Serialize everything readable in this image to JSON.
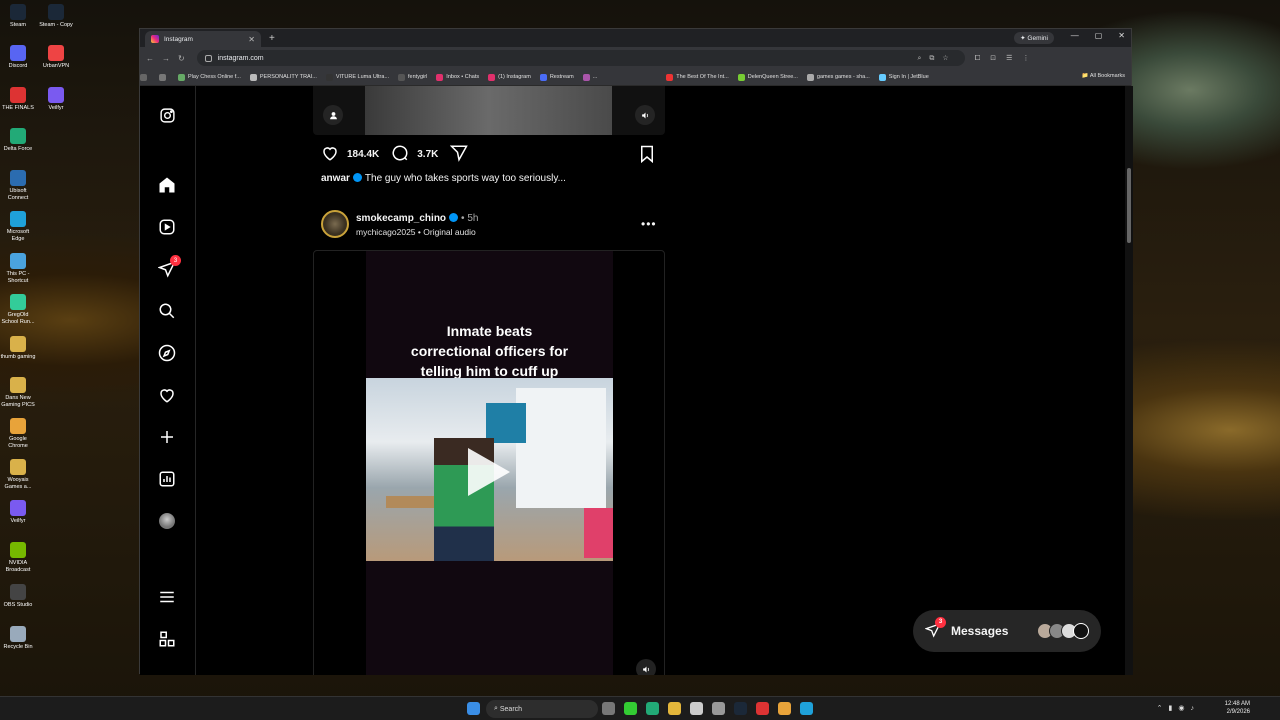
{
  "desktop": {
    "icons": [
      {
        "label": "Steam",
        "color": "#1b2838"
      },
      {
        "label": "Discord",
        "color": "#5865f2"
      },
      {
        "label": "THE FINALS",
        "color": "#d33"
      },
      {
        "label": "Delta Force",
        "color": "#2a7"
      },
      {
        "label": "Ubisoft Connect",
        "color": "#2b6cb0"
      },
      {
        "label": "Microsoft Edge",
        "color": "#1fa1d9"
      },
      {
        "label": "This PC - Shortcut",
        "color": "#4aa3df"
      },
      {
        "label": "GregOld School Run...",
        "color": "#3c9"
      },
      {
        "label": "thumb gaming",
        "color": "#d9b14a"
      },
      {
        "label": "Dans New Gaming PICS",
        "color": "#d9b14a"
      },
      {
        "label": "Google Chrome",
        "color": "#e8a33a"
      },
      {
        "label": "Wooyais Games a...",
        "color": "#d9b14a"
      },
      {
        "label": "Veilfyr",
        "color": "#7a5af0"
      },
      {
        "label": "NVIDIA Broadcast",
        "color": "#76b900"
      },
      {
        "label": "OBS Studio",
        "color": "#444"
      },
      {
        "label": "Recycle Bin",
        "color": "#9ab"
      }
    ],
    "icons_col2": [
      {
        "label": "Steam - Copy",
        "color": "#1b2838"
      },
      {
        "label": "UrbanVPN",
        "color": "#e44"
      },
      {
        "label": "Veilfyr",
        "color": "#7a5af0"
      }
    ]
  },
  "browser": {
    "tab_title": "Instagram",
    "gemini_label": "Gemini",
    "url": "instagram.com",
    "bookmarks": [
      "Play Chess Online f...",
      "PERSONALITY TRAI...",
      "VITURE Luma Ultra...",
      "fentygirl",
      "Inbox • Chats",
      "(1) Instagram",
      "Restream",
      "...",
      "The Best Of The Int...",
      "DelenQueen Stree...",
      "games games - sha...",
      "Sign In | JetBlue"
    ],
    "all_bookmarks": "All Bookmarks"
  },
  "instagram": {
    "notif_count": "3",
    "post1": {
      "likes": "184.4K",
      "comments": "3.7K",
      "author": "anwar",
      "caption": "The guy who takes sports way too seriously..."
    },
    "post2": {
      "author": "smokecamp_chino",
      "time": "5h",
      "audio_source": "mychicago2025",
      "audio_label": "Original audio",
      "video_title_1": "Inmate beats",
      "video_title_2": "correctional officers for",
      "video_title_3": "telling him to cuff up"
    },
    "messages": {
      "label": "Messages",
      "count": "3"
    }
  },
  "taskbar": {
    "search_placeholder": "Search",
    "time": "12:48 AM",
    "date": "2/9/2026"
  }
}
